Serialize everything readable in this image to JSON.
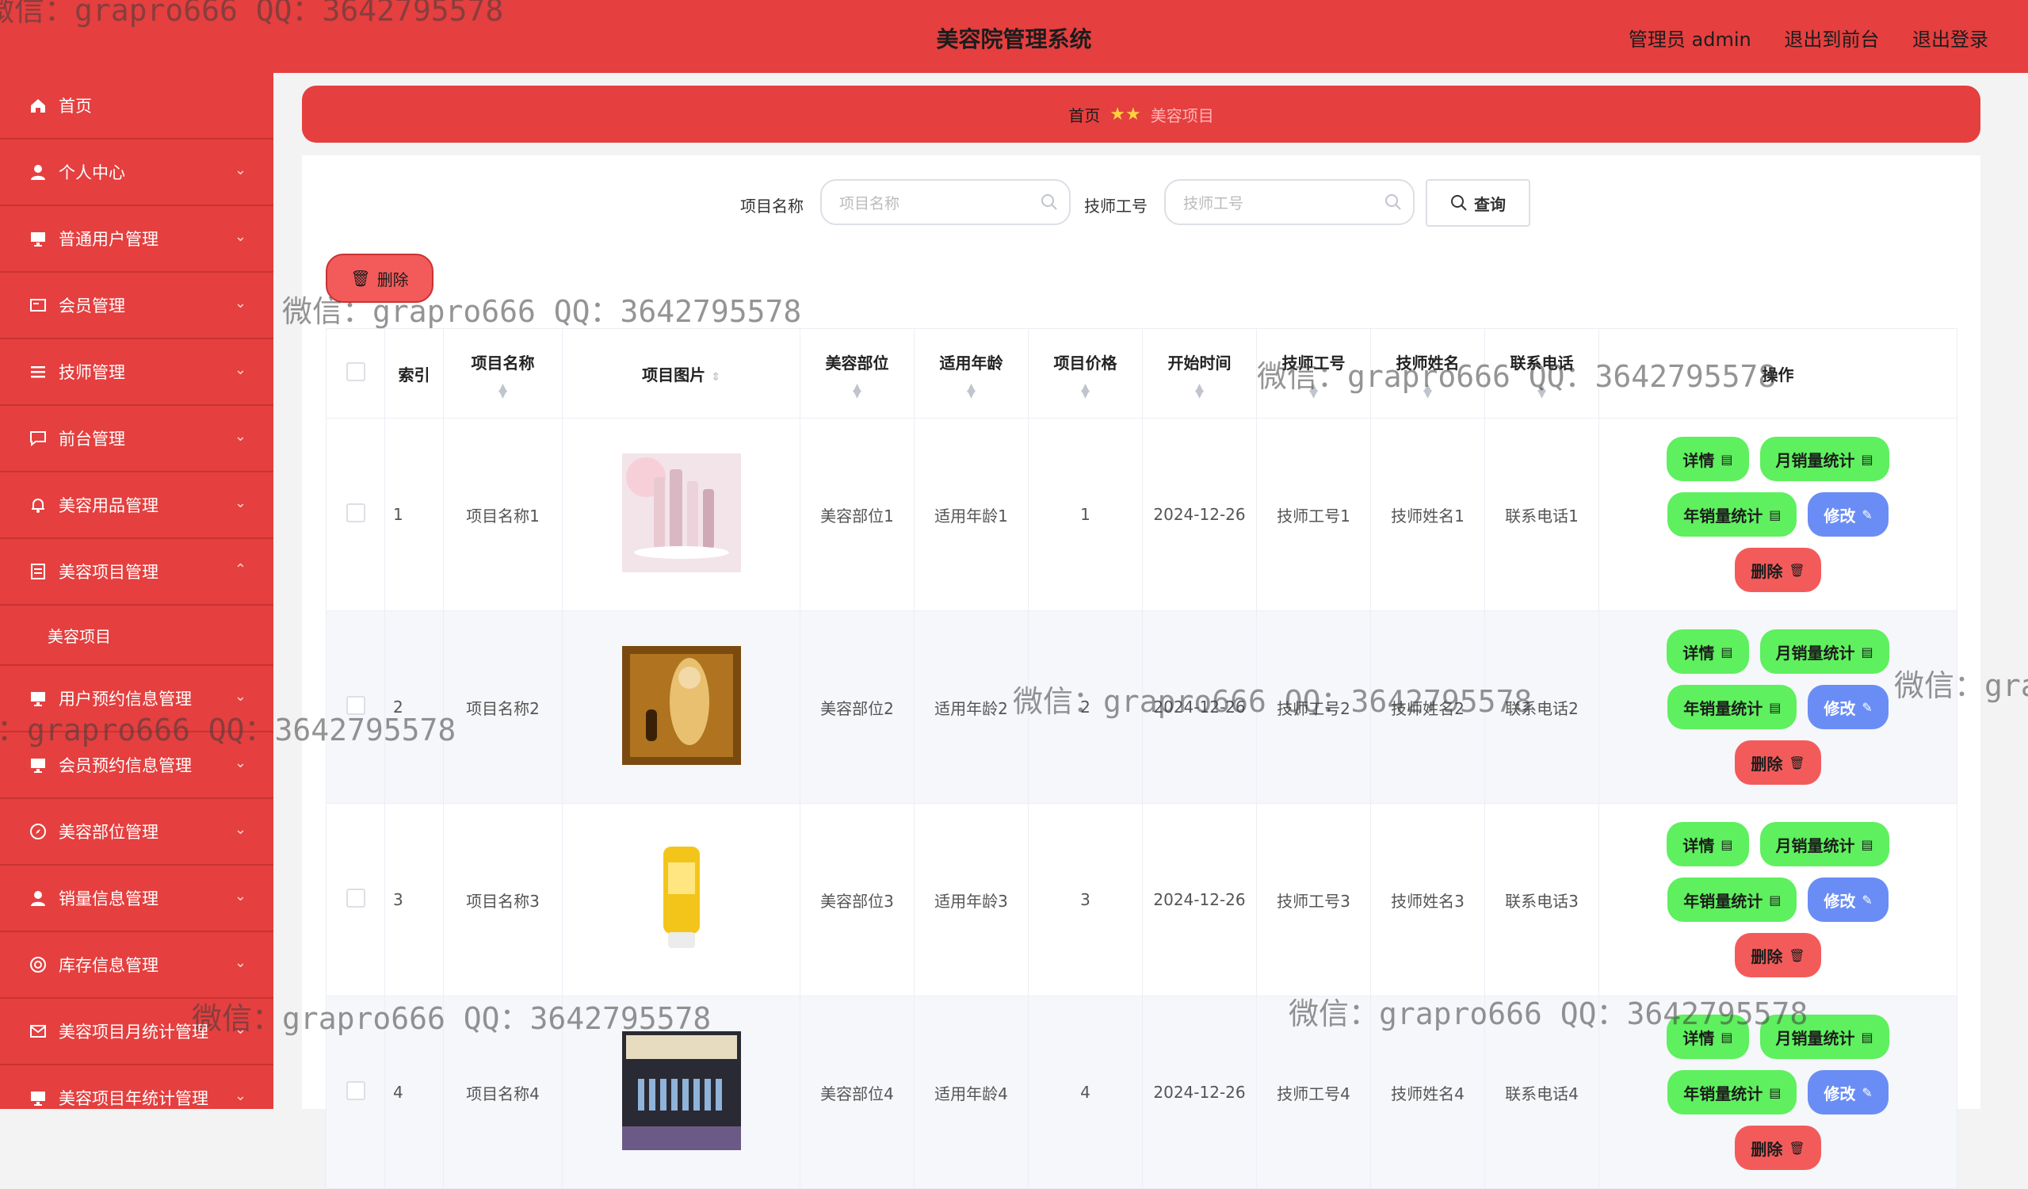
{
  "header": {
    "title": "美容院管理系统",
    "admin_label": "管理员 admin",
    "back_front": "退出到前台",
    "logout": "退出登录"
  },
  "sidebar": {
    "items": [
      {
        "label": "首页",
        "icon": "home-icon",
        "chevron": ""
      },
      {
        "label": "个人中心",
        "icon": "user-icon",
        "chevron": "⌄"
      },
      {
        "label": "普通用户管理",
        "icon": "monitor-icon",
        "chevron": "⌄"
      },
      {
        "label": "会员管理",
        "icon": "card-icon",
        "chevron": "⌄"
      },
      {
        "label": "技师管理",
        "icon": "list-icon",
        "chevron": "⌄"
      },
      {
        "label": "前台管理",
        "icon": "chat-icon",
        "chevron": "⌄"
      },
      {
        "label": "美容用品管理",
        "icon": "bell-icon",
        "chevron": "⌄"
      },
      {
        "label": "美容项目管理",
        "icon": "document-icon",
        "chevron": "⌃"
      }
    ],
    "sub_item": "美容项目",
    "items2": [
      {
        "label": "用户预约信息管理",
        "icon": "monitor-icon",
        "chevron": "⌄"
      },
      {
        "label": "会员预约信息管理",
        "icon": "monitor-icon",
        "chevron": "⌄"
      },
      {
        "label": "美容部位管理",
        "icon": "compass-icon",
        "chevron": "⌄"
      },
      {
        "label": "销量信息管理",
        "icon": "user-icon",
        "chevron": "⌄"
      },
      {
        "label": "库存信息管理",
        "icon": "target-icon",
        "chevron": "⌄"
      },
      {
        "label": "美容项目月统计管理",
        "icon": "mail-icon",
        "chevron": "⌄"
      },
      {
        "label": "美容项目年统计管理",
        "icon": "monitor-icon",
        "chevron": "⌄"
      }
    ]
  },
  "breadcrumb": {
    "home": "首页",
    "stars": "★★",
    "current": "美容项目"
  },
  "search": {
    "name_label": "项目名称",
    "name_placeholder": "项目名称",
    "tech_label": "技师工号",
    "tech_placeholder": "技师工号",
    "query_button": "查询"
  },
  "toolbar": {
    "delete_label": "删除"
  },
  "table": {
    "headers": [
      "索引",
      "项目名称",
      "项目图片",
      "美容部位",
      "适用年龄",
      "项目价格",
      "开始时间",
      "技师工号",
      "技师姓名",
      "联系电话",
      "操作"
    ],
    "rows": [
      {
        "idx": "1",
        "name": "项目名称1",
        "part": "美容部位1",
        "age": "适用年龄1",
        "price": "1",
        "time": "2024-12-26",
        "tech_no": "技师工号1",
        "tech_name": "技师姓名1",
        "phone": "联系电话1"
      },
      {
        "idx": "2",
        "name": "项目名称2",
        "part": "美容部位2",
        "age": "适用年龄2",
        "price": "2",
        "time": "2024-12-26",
        "tech_no": "技师工号2",
        "tech_name": "技师姓名2",
        "phone": "联系电话2"
      },
      {
        "idx": "3",
        "name": "项目名称3",
        "part": "美容部位3",
        "age": "适用年龄3",
        "price": "3",
        "time": "2024-12-26",
        "tech_no": "技师工号3",
        "tech_name": "技师姓名3",
        "phone": "联系电话3"
      },
      {
        "idx": "4",
        "name": "项目名称4",
        "part": "美容部位4",
        "age": "适用年龄4",
        "price": "4",
        "time": "2024-12-26",
        "tech_no": "技师工号4",
        "tech_name": "技师姓名4",
        "phone": "联系电话4"
      }
    ],
    "ops": {
      "detail": "详情",
      "month_stat": "月销量统计",
      "year_stat": "年销量统计",
      "edit": "修改",
      "delete": "删除"
    }
  },
  "watermark": "微信：grapro666 QQ：3642795578",
  "colors": {
    "primary_red": "#e53f3f",
    "green": "#5ef05e",
    "blue": "#6a8df5",
    "danger": "#f35b5b"
  }
}
